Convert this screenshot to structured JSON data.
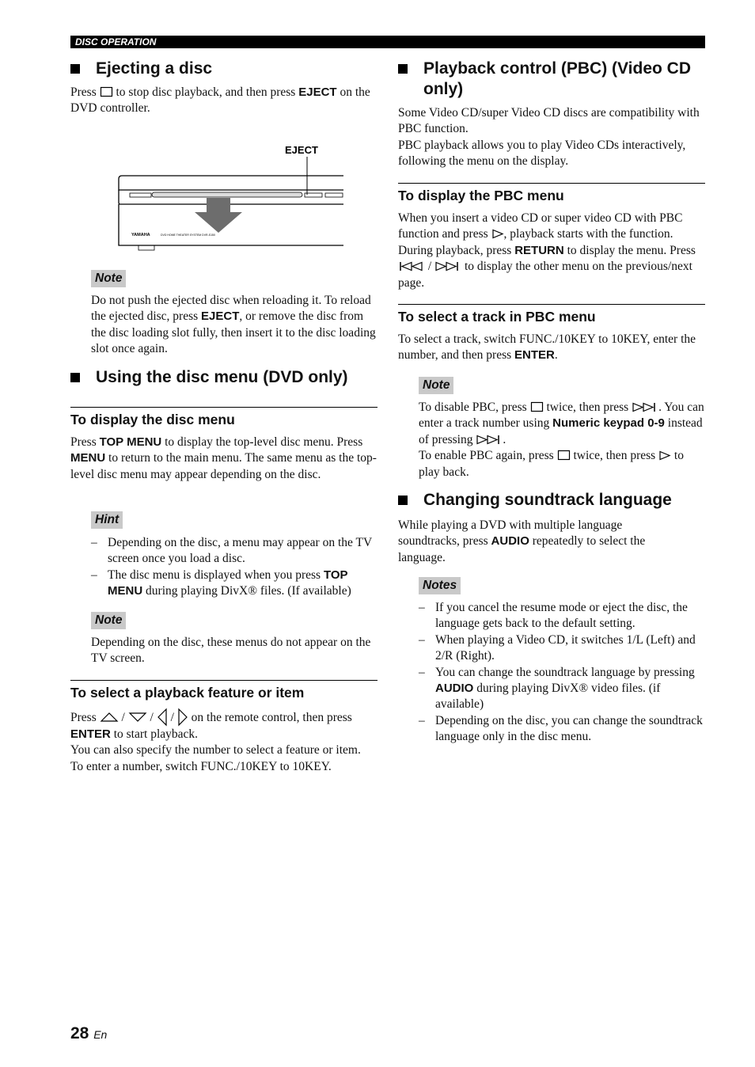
{
  "header": {
    "section": "DISC OPERATION"
  },
  "left": {
    "eject": {
      "title": "Ejecting a disc",
      "body": [
        {
          "t": "Press "
        },
        {
          "i": "stop"
        },
        {
          "t": " to stop disc playback, and then press "
        },
        {
          "b": "EJECT"
        },
        {
          "t": " on the DVD controller."
        }
      ],
      "figure": {
        "callout": "EJECT",
        "brand": "YAMAHA",
        "model": "DVD HOME THEATER SYSTEM DVR-S150"
      },
      "note_label": "Note",
      "note": [
        {
          "t": "Do not push the ejected disc when reloading it. To reload the ejected disc, press "
        },
        {
          "b": "EJECT"
        },
        {
          "t": ", or remove the disc from the disc loading slot fully, then insert it to the disc loading slot once again."
        }
      ]
    },
    "discmenu": {
      "title": "Using the disc menu (DVD only)",
      "sub1": "To display the disc menu",
      "body1": [
        {
          "t": "Press "
        },
        {
          "b": "TOP MENU"
        },
        {
          "t": " to display the top-level disc menu. Press "
        },
        {
          "b": "MENU"
        },
        {
          "t": " to return to the main menu. The same menu as the top-level disc menu may appear depending on the disc."
        }
      ],
      "hint_label": "Hint",
      "hints": [
        [
          {
            "t": "Depending on the disc, a menu may appear on the TV screen once you load a disc."
          }
        ],
        [
          {
            "t": "The disc menu is displayed when you press "
          },
          {
            "b": "TOP MENU"
          },
          {
            "t": " during playing DivX® files. (If available)"
          }
        ]
      ],
      "note_label": "Note",
      "note": [
        {
          "t": "Depending on the disc, these menus do not appear on the TV screen."
        }
      ],
      "sub2": "To select a playback feature or item",
      "body2": [
        {
          "t": "Press "
        },
        {
          "i": "up"
        },
        {
          "t": " / "
        },
        {
          "i": "down"
        },
        {
          "t": " / "
        },
        {
          "i": "left"
        },
        {
          "t": " / "
        },
        {
          "i": "right"
        },
        {
          "t": " on the remote control, then press "
        },
        {
          "b": "ENTER"
        },
        {
          "t": " to start playback."
        },
        {
          "br": 1
        },
        {
          "t": "You can also specify the number to select a feature or item."
        },
        {
          "br": 1
        },
        {
          "t": "To enter a number, switch FUNC./10KEY to 10KEY."
        }
      ]
    }
  },
  "right": {
    "pbc": {
      "title": "Playback control (PBC) (Video CD only)",
      "body": [
        {
          "t": "Some Video CD/super Video CD discs are compatibility with PBC function."
        },
        {
          "br": 1
        },
        {
          "t": "PBC playback allows you to play Video CDs interactively, following the menu on the display."
        }
      ],
      "sub1": "To display the PBC menu",
      "body1": [
        {
          "t": "When you insert a video CD or super video CD with PBC function and press "
        },
        {
          "i": "play"
        },
        {
          "t": ", playback starts with the function. During playback, press "
        },
        {
          "b": "RETURN"
        },
        {
          "t": " to display the menu. Press "
        },
        {
          "i": "prev"
        },
        {
          "t": " / "
        },
        {
          "i": "next"
        },
        {
          "t": " to display the other menu on the previous/next page."
        }
      ],
      "sub2": "To select a track in PBC menu",
      "body2": [
        {
          "t": "To select a track, switch FUNC./10KEY to 10KEY, enter the number, and then press "
        },
        {
          "b": "ENTER"
        },
        {
          "t": "."
        }
      ],
      "note_label": "Note",
      "note": [
        {
          "t": "To disable PBC, press "
        },
        {
          "i": "stop"
        },
        {
          "t": " twice, then press "
        },
        {
          "i": "next"
        },
        {
          "t": ". You can enter a track number using "
        },
        {
          "b": "Numeric keypad 0-9"
        },
        {
          "t": " instead of pressing "
        },
        {
          "i": "next"
        },
        {
          "t": "."
        },
        {
          "br": 1
        },
        {
          "t": "To enable PBC again, press "
        },
        {
          "i": "stop"
        },
        {
          "t": " twice, then press "
        },
        {
          "i": "play"
        },
        {
          "t": " to play back."
        }
      ]
    },
    "sound": {
      "title": "Changing soundtrack language",
      "body": [
        {
          "t": "While playing a DVD with multiple language soundtracks, press "
        },
        {
          "b": "AUDIO"
        },
        {
          "t": " repeatedly to select the language."
        }
      ],
      "notes_label": "Notes",
      "notes": [
        [
          {
            "t": "If you cancel the resume mode or eject the disc, the language gets back to the default setting."
          }
        ],
        [
          {
            "t": "When playing a Video CD, it switches 1/L (Left) and 2/R (Right)."
          }
        ],
        [
          {
            "t": "You can change the soundtrack language by pressing "
          },
          {
            "b": "AUDIO"
          },
          {
            "t": " during playing DivX® video files. (if available)"
          }
        ],
        [
          {
            "t": "Depending on the disc, you can change the soundtrack language only in the disc menu."
          }
        ]
      ]
    }
  },
  "footer": {
    "page": "28",
    "lang": "En"
  }
}
